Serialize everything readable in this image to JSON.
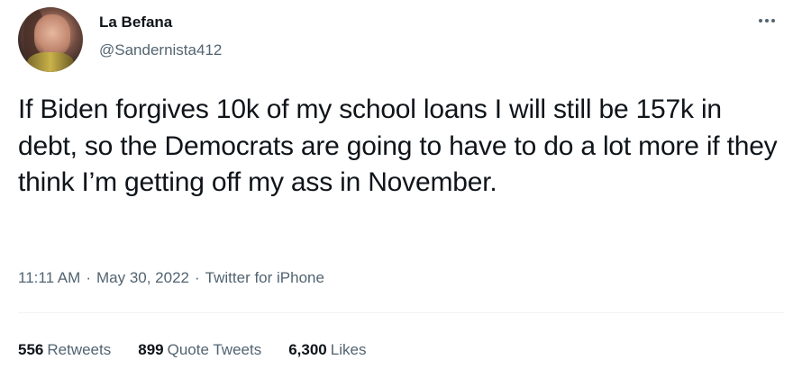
{
  "author": {
    "display_name": "La Befana",
    "handle": "@Sandernista412"
  },
  "tweet": {
    "text": "If Biden forgives 10k of my school loans I will still be 157k in debt, so the Democrats are going to have to do a lot more if they think I’m getting off my ass in November.",
    "time": "11:11 AM",
    "date": "May 30, 2022",
    "source": "Twitter for iPhone"
  },
  "stats": {
    "retweets_count": "556",
    "retweets_label": "Retweets",
    "quotes_count": "899",
    "quotes_label": "Quote Tweets",
    "likes_count": "6,300",
    "likes_label": "Likes"
  },
  "icons": {
    "more": "more-horizontal-icon"
  },
  "colors": {
    "text_primary": "#0f1419",
    "text_secondary": "#536471",
    "divider": "#eff3f4"
  }
}
